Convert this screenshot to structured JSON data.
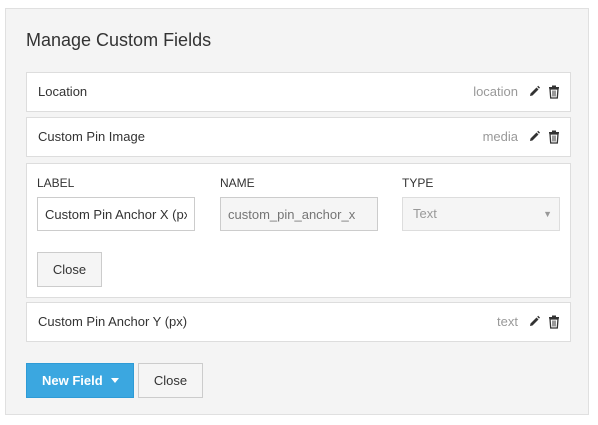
{
  "dialog": {
    "title": "Manage Custom Fields"
  },
  "fields": [
    {
      "label": "Location",
      "type": "location"
    },
    {
      "label": "Custom Pin Image",
      "type": "media"
    },
    {
      "label": "Custom Pin Anchor Y (px)",
      "type": "text"
    }
  ],
  "editor": {
    "label_header": "LABEL",
    "name_header": "NAME",
    "type_header": "TYPE",
    "label_value": "Custom Pin Anchor X (px)",
    "name_value": "custom_pin_anchor_x",
    "type_value": "Text",
    "close_label": "Close"
  },
  "footer": {
    "new_field_label": "New Field",
    "close_label": "Close"
  },
  "icons": {
    "edit": "pencil-icon",
    "delete": "trash-icon",
    "dropdown": "caret-down-icon"
  },
  "colors": {
    "primary": "#3ba7e0",
    "panel_bg": "#f4f4f4",
    "muted_text": "#999999"
  }
}
